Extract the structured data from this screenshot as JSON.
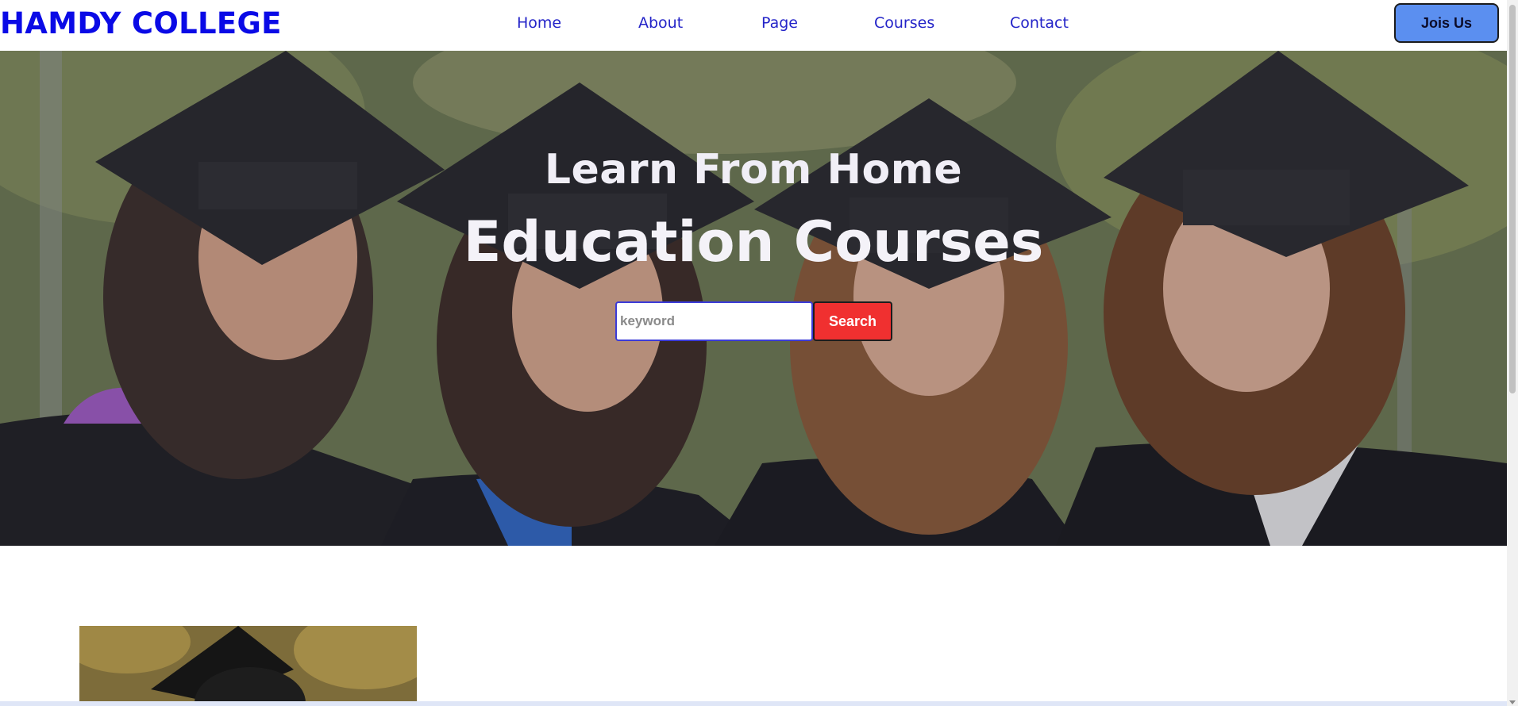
{
  "header": {
    "logo": "HAMDY COLLEGE",
    "nav": [
      {
        "label": "Home"
      },
      {
        "label": "About"
      },
      {
        "label": "Page"
      },
      {
        "label": "Courses"
      },
      {
        "label": "Contact"
      }
    ],
    "join_label": "Jois Us"
  },
  "hero": {
    "subtitle": "Learn From Home",
    "title": "Education Courses",
    "search": {
      "placeholder": "keyword",
      "button_label": "Search"
    }
  },
  "colors": {
    "brand": "#0a0ae6",
    "nav_link": "#2323c8",
    "join_button": "#5b8ff0",
    "search_button": "#f03030",
    "hero_text": "#f4f2f8"
  }
}
